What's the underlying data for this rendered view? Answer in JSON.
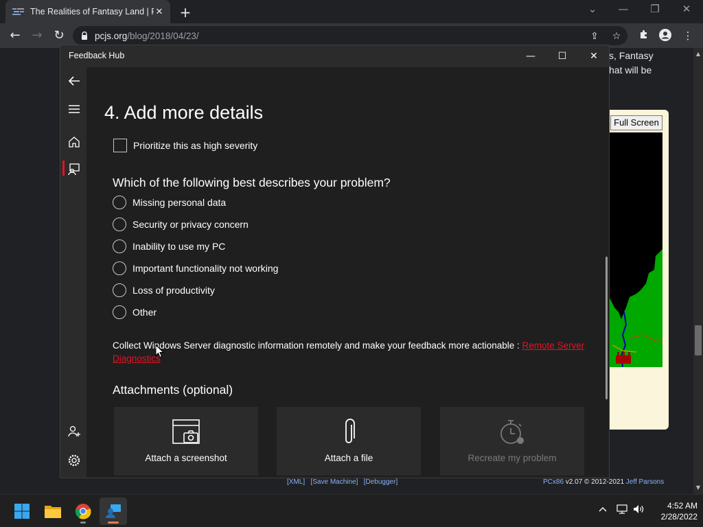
{
  "browser": {
    "tab_title": "The Realities of Fantasy Land | PC",
    "url_host": "pcjs.org",
    "url_path": "/blog/2018/04/23/"
  },
  "webpage": {
    "text_line1": "s, Fantasy",
    "text_line2": "hat will be",
    "full_screen_label": "Full Screen",
    "links": {
      "xml": "[XML]",
      "save_machine": "[Save Machine]",
      "debugger": "[Debugger]"
    },
    "credit_app": "PCx86",
    "credit_text": " v2.07 © 2012-2021 ",
    "credit_author": "Jeff Parsons"
  },
  "feedback_hub": {
    "window_title": "Feedback Hub",
    "section_title": "4. Add more details",
    "severity_label": "Prioritize this as high severity",
    "question": "Which of the following best describes your problem?",
    "options": [
      "Missing personal data",
      "Security or privacy concern",
      "Inability to use my PC",
      "Important functionality not working",
      "Loss of productivity",
      "Other"
    ],
    "diagnostic_text": "Collect Windows Server diagnostic information remotely and make your feedback more actionable : ",
    "diagnostic_link": "Remote Server Diagnostics",
    "attachments_title": "Attachments (optional)",
    "tiles": {
      "screenshot": "Attach a screenshot",
      "file": "Attach a file",
      "recreate": "Recreate my problem"
    }
  },
  "taskbar": {
    "time": "4:52 AM",
    "date": "2/28/2022"
  },
  "colors": {
    "accent_red": "#e81123",
    "link_blue": "#8ab4f8",
    "active_indicator": "#e87c57"
  }
}
